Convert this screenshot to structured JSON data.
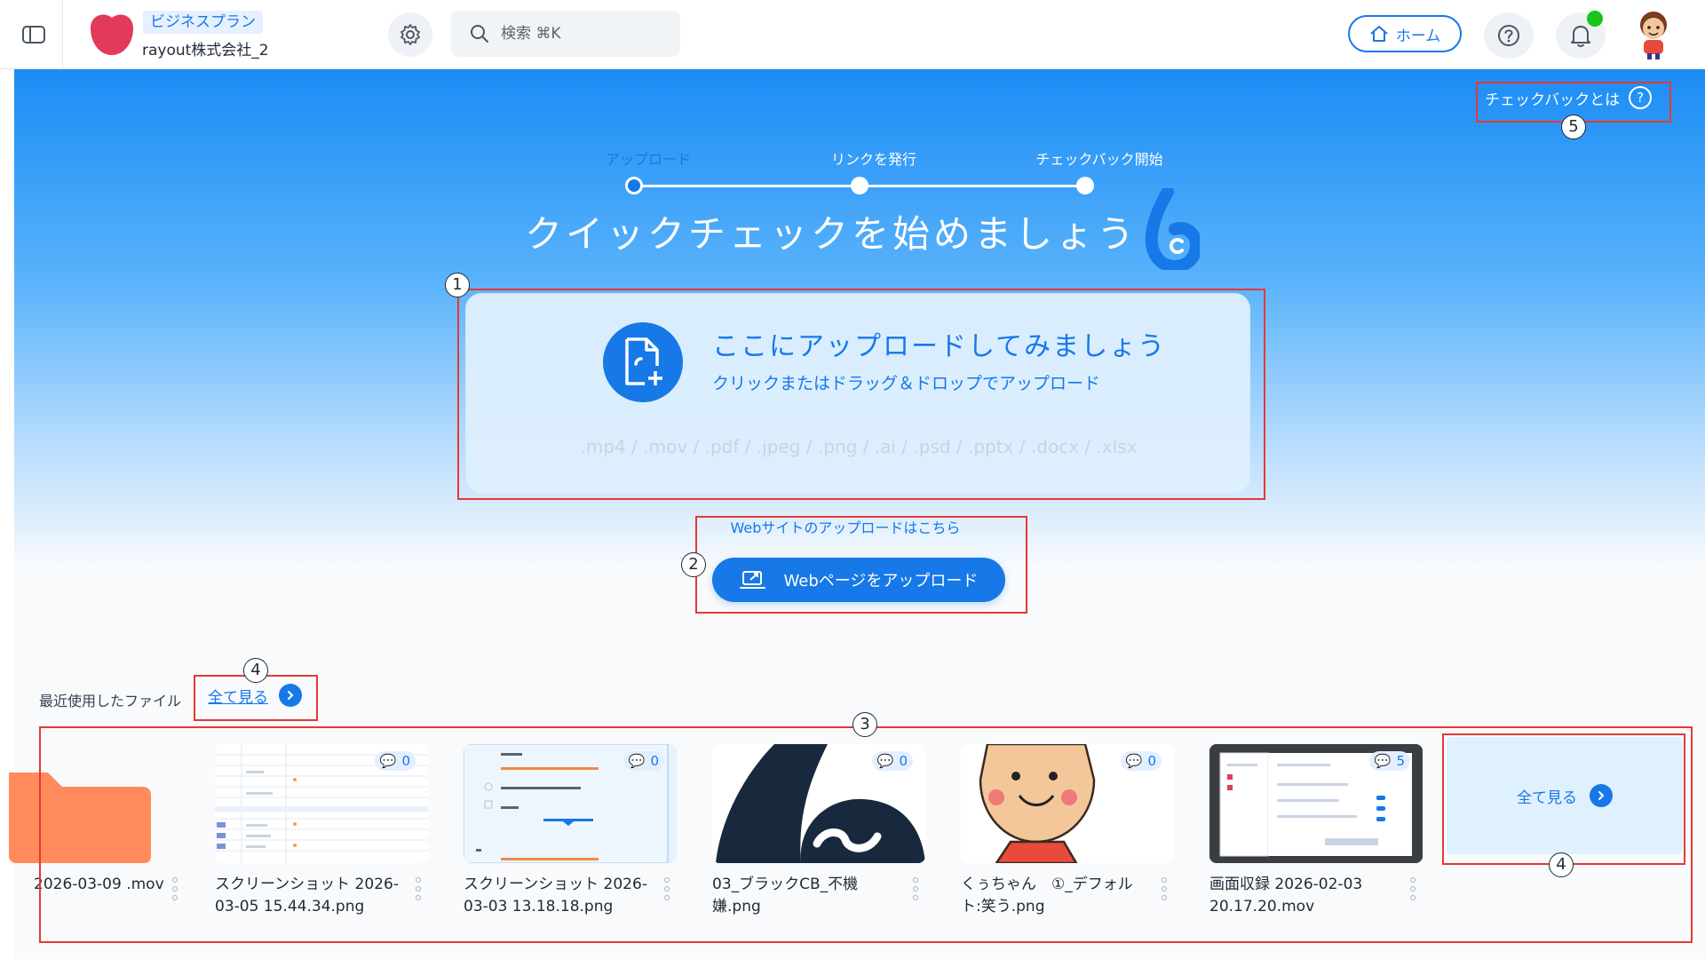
{
  "header": {
    "plan": "ビジネスプラン",
    "company": "rayout株式会社_2",
    "search_placeholder": "検索 ⌘K",
    "home_label": "ホーム"
  },
  "colors": {
    "accent": "#1778e8",
    "notification_dot": "#18c51a",
    "logo": "#e23a5a",
    "folder": "#ff8a5c",
    "annotation": "#e53935"
  },
  "hero": {
    "what_is": "チェックバックとは",
    "steps": [
      {
        "label": "アップロード",
        "active": true
      },
      {
        "label": "リンクを発行",
        "active": false
      },
      {
        "label": "チェックバック開始",
        "active": false
      }
    ],
    "title": "クイックチェックを始めましょう"
  },
  "upload": {
    "title": "ここにアップロードしてみましょう",
    "subtitle": "クリックまたはドラッグ＆ドロップでアップロード",
    "types": ".mp4 / .mov / .pdf / .jpeg / .png / .ai / .psd / .pptx / .docx / .xlsx"
  },
  "web_upload": {
    "hint": "Webサイトのアップロードはこちら",
    "button": "Webページをアップロード"
  },
  "recent": {
    "label": "最近使用したファイル",
    "view_all": "全て見る",
    "files": [
      {
        "name": "2026-03-09 .mov",
        "comments": null,
        "kind": "folder"
      },
      {
        "name": "スクリーンショット 2026-03-05 15.44.34.png",
        "comments": "0",
        "kind": "table"
      },
      {
        "name": "スクリーンショット 2026-03-03 13.18.18.png",
        "comments": "0",
        "kind": "doc"
      },
      {
        "name": "03_ブラックCB_不機嫌.png",
        "comments": "0",
        "kind": "logo"
      },
      {
        "name": "くぅちゃん　①_デフォルト:笑う.png",
        "comments": "0",
        "kind": "character"
      },
      {
        "name": "画面収録 2026-02-03 20.17.20.mov",
        "comments": "5",
        "kind": "screen"
      }
    ],
    "see_all_card": "全て見る"
  },
  "annotations": [
    "1",
    "2",
    "3",
    "4",
    "4",
    "5"
  ]
}
